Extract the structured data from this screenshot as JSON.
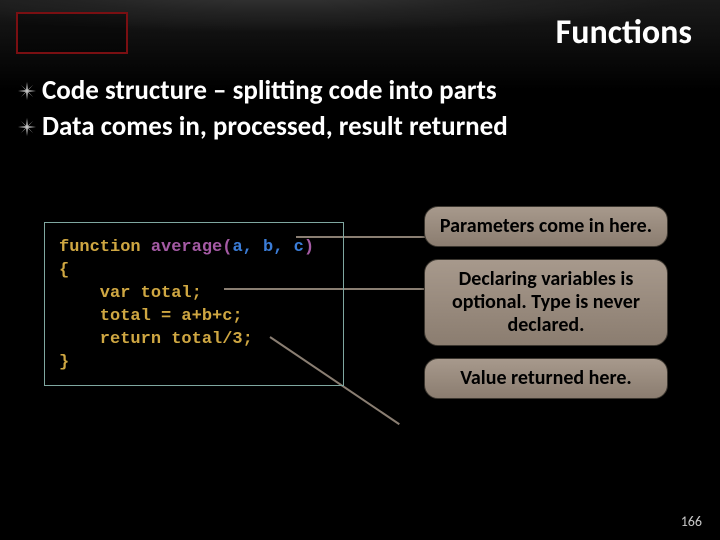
{
  "title": "Functions",
  "bullets": [
    "Code structure – splitting code into parts",
    "Data comes in, processed, result returned"
  ],
  "code": {
    "l1_kw": "function ",
    "l1_fn": "average(",
    "l1_params": "a, b, c",
    "l1_close": ")",
    "l2": "{",
    "l3": "    var total;",
    "l4": "    total = a+b+c;",
    "l5": "    return total/3;",
    "l6": "}"
  },
  "callouts": {
    "c1": "Parameters come in here.",
    "c2": "Declaring variables is optional. Type is never declared.",
    "c3": "Value returned here."
  },
  "page_number": "166"
}
